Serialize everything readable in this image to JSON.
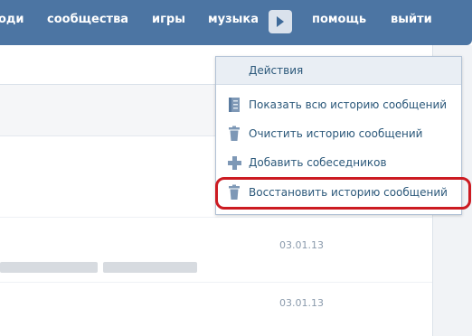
{
  "nav": {
    "items": [
      {
        "label": "оди"
      },
      {
        "label": "сообщества"
      },
      {
        "label": "игры"
      },
      {
        "label": "музыка"
      },
      {
        "label": "помощь"
      },
      {
        "label": "выйти"
      }
    ]
  },
  "menu": {
    "header": "Действия",
    "items": [
      {
        "label": "Показать всю историю сообщений",
        "icon": "history-list-icon"
      },
      {
        "label": "Очистить историю сообщений",
        "icon": "trash-icon"
      },
      {
        "label": "Добавить собеседников",
        "icon": "plus-icon"
      },
      {
        "label": "Восстановить историю сообщений",
        "icon": "trash-icon"
      }
    ]
  },
  "messages": [
    {
      "date": "03.01.13"
    },
    {
      "date": "03.01.13"
    }
  ],
  "colors": {
    "nav_background": "#4c75a3",
    "menu_text": "#2b587a",
    "highlight": "#cc1b22"
  }
}
